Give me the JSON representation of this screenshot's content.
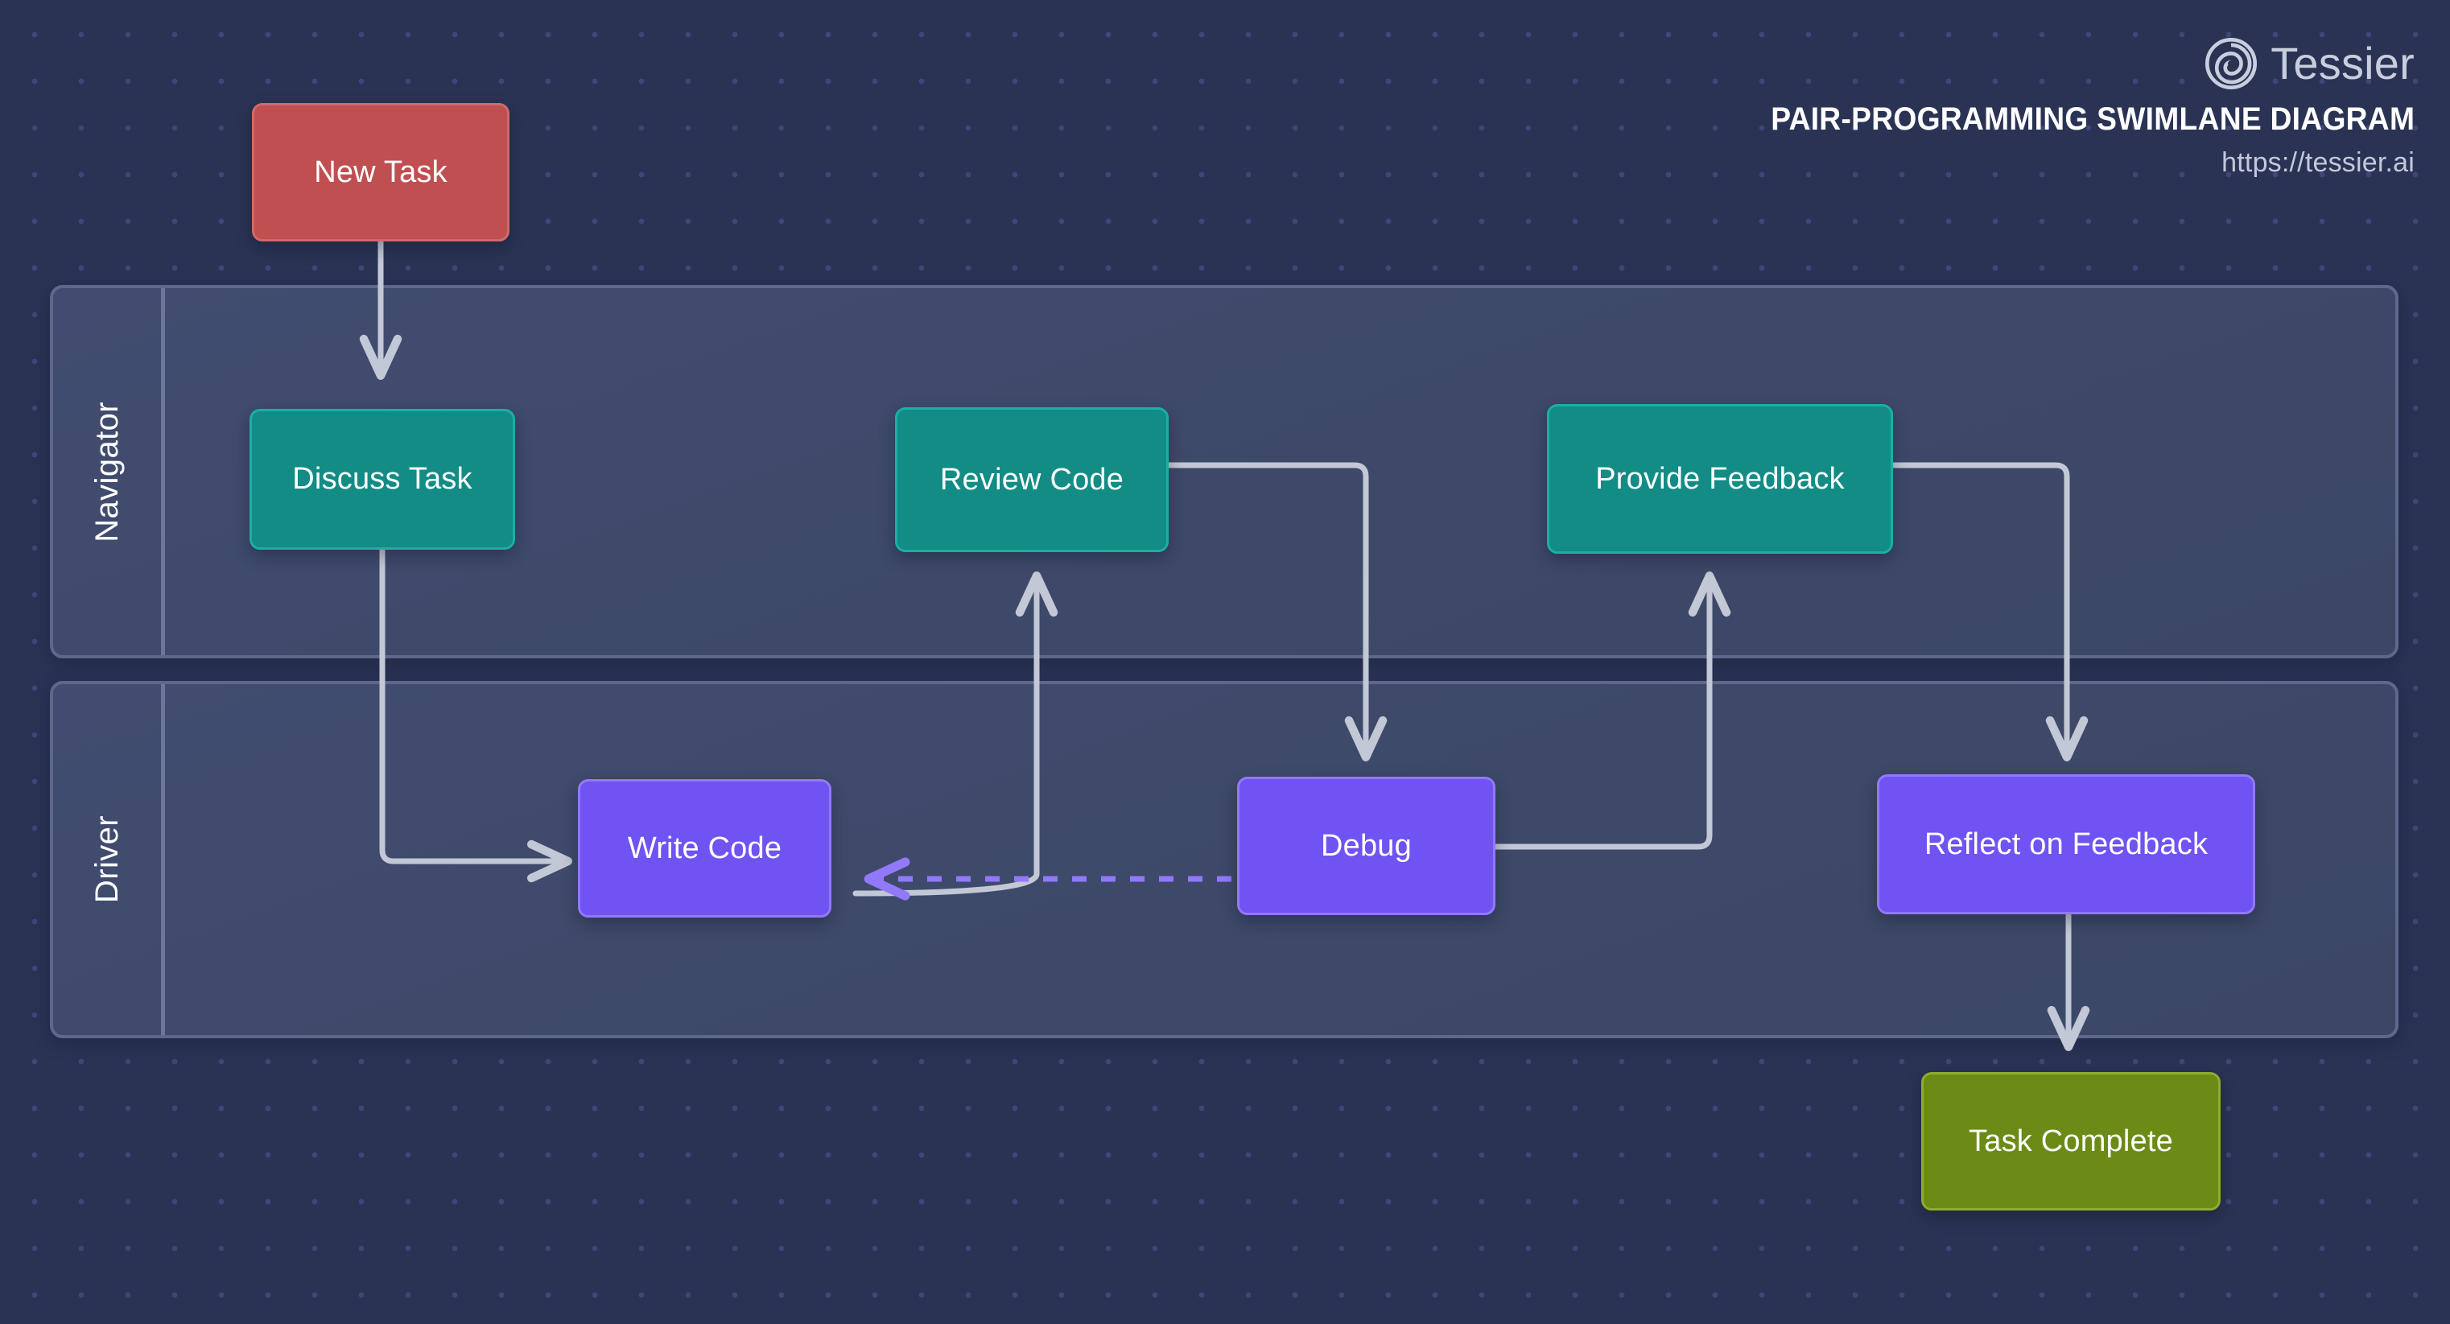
{
  "brand": {
    "name": "Tessier",
    "logo_icon": "spiral-logo-icon",
    "title": "PAIR-PROGRAMMING SWIMLANE DIAGRAM",
    "url": "https://tessier.ai"
  },
  "colors": {
    "background": "#2a3354",
    "dot": "#3d4878",
    "lane_fill": "#414c70",
    "lane_border": "#5d688c",
    "start_node": "#c04f51",
    "navigator_node": "#128c85",
    "driver_node": "#7152f3",
    "end_node": "#6b8b16",
    "edge": "#c3c8d6",
    "edge_dashed": "#9279fa"
  },
  "lanes": [
    {
      "id": "navigator",
      "label": "Navigator"
    },
    {
      "id": "driver",
      "label": "Driver"
    }
  ],
  "nodes": [
    {
      "id": "new-task",
      "label": "New Task",
      "lane": "none",
      "type": "start"
    },
    {
      "id": "discuss-task",
      "label": "Discuss Task",
      "lane": "navigator",
      "type": "process"
    },
    {
      "id": "review-code",
      "label": "Review Code",
      "lane": "navigator",
      "type": "process"
    },
    {
      "id": "provide-feedback",
      "label": "Provide Feedback",
      "lane": "navigator",
      "type": "process"
    },
    {
      "id": "write-code",
      "label": "Write Code",
      "lane": "driver",
      "type": "process"
    },
    {
      "id": "debug",
      "label": "Debug",
      "lane": "driver",
      "type": "process"
    },
    {
      "id": "reflect-on-feedback",
      "label": "Reflect on Feedback",
      "lane": "driver",
      "type": "process"
    },
    {
      "id": "task-complete",
      "label": "Task Complete",
      "lane": "none",
      "type": "end"
    }
  ],
  "edges": [
    {
      "from": "new-task",
      "to": "discuss-task",
      "style": "solid"
    },
    {
      "from": "discuss-task",
      "to": "write-code",
      "style": "solid"
    },
    {
      "from": "write-code",
      "to": "review-code",
      "style": "solid"
    },
    {
      "from": "review-code",
      "to": "debug",
      "style": "solid"
    },
    {
      "from": "debug",
      "to": "write-code",
      "style": "dashed"
    },
    {
      "from": "debug",
      "to": "provide-feedback",
      "style": "solid"
    },
    {
      "from": "provide-feedback",
      "to": "reflect-on-feedback",
      "style": "solid"
    },
    {
      "from": "reflect-on-feedback",
      "to": "task-complete",
      "style": "solid"
    }
  ]
}
